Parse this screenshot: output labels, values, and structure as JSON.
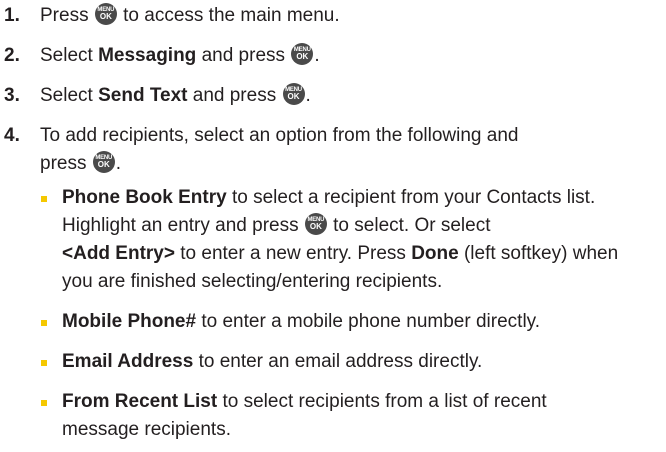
{
  "steps": [
    {
      "num": "1.",
      "pre": "Press",
      "key": "menu-ok-key",
      "post": "to access the main menu."
    },
    {
      "num": "2.",
      "pre": "Select",
      "bold": "Messaging",
      "mid": "and press",
      "key": "menu-ok-key",
      "post": "."
    },
    {
      "num": "3.",
      "pre": "Select",
      "bold": "Send Text",
      "mid": "and press",
      "key": "menu-ok-key",
      "post": "."
    },
    {
      "num": "4.",
      "line1": "To add recipients, select an option from the following and",
      "line2": "press",
      "key": "menu-ok-key",
      "post": "."
    }
  ],
  "key_label": {
    "top": "MENU",
    "bottom": "OK"
  },
  "options": [
    {
      "bold": "Phone Book Entry",
      "text1": "to select a recipient from your Contacts list.",
      "text2": "Highlight an entry and press",
      "text3": "to select. Or select",
      "bold2": "<Add Entry>",
      "text4": "to enter a new entry. Press",
      "bold3": "Done",
      "text5": "(left softkey) when",
      "text6": "you are finished selecting/entering recipients."
    },
    {
      "bold": "Mobile Phone#",
      "text": "to enter a mobile phone number directly."
    },
    {
      "bold": "Email Address",
      "text": "to enter an email address directly."
    },
    {
      "bold": "From Recent List",
      "text1": "to select recipients from a list of recent",
      "text2": "message recipients."
    }
  ],
  "colors": {
    "bullet": "#f5c800",
    "key_bg": "#4a4a4a",
    "text": "#231f20"
  }
}
